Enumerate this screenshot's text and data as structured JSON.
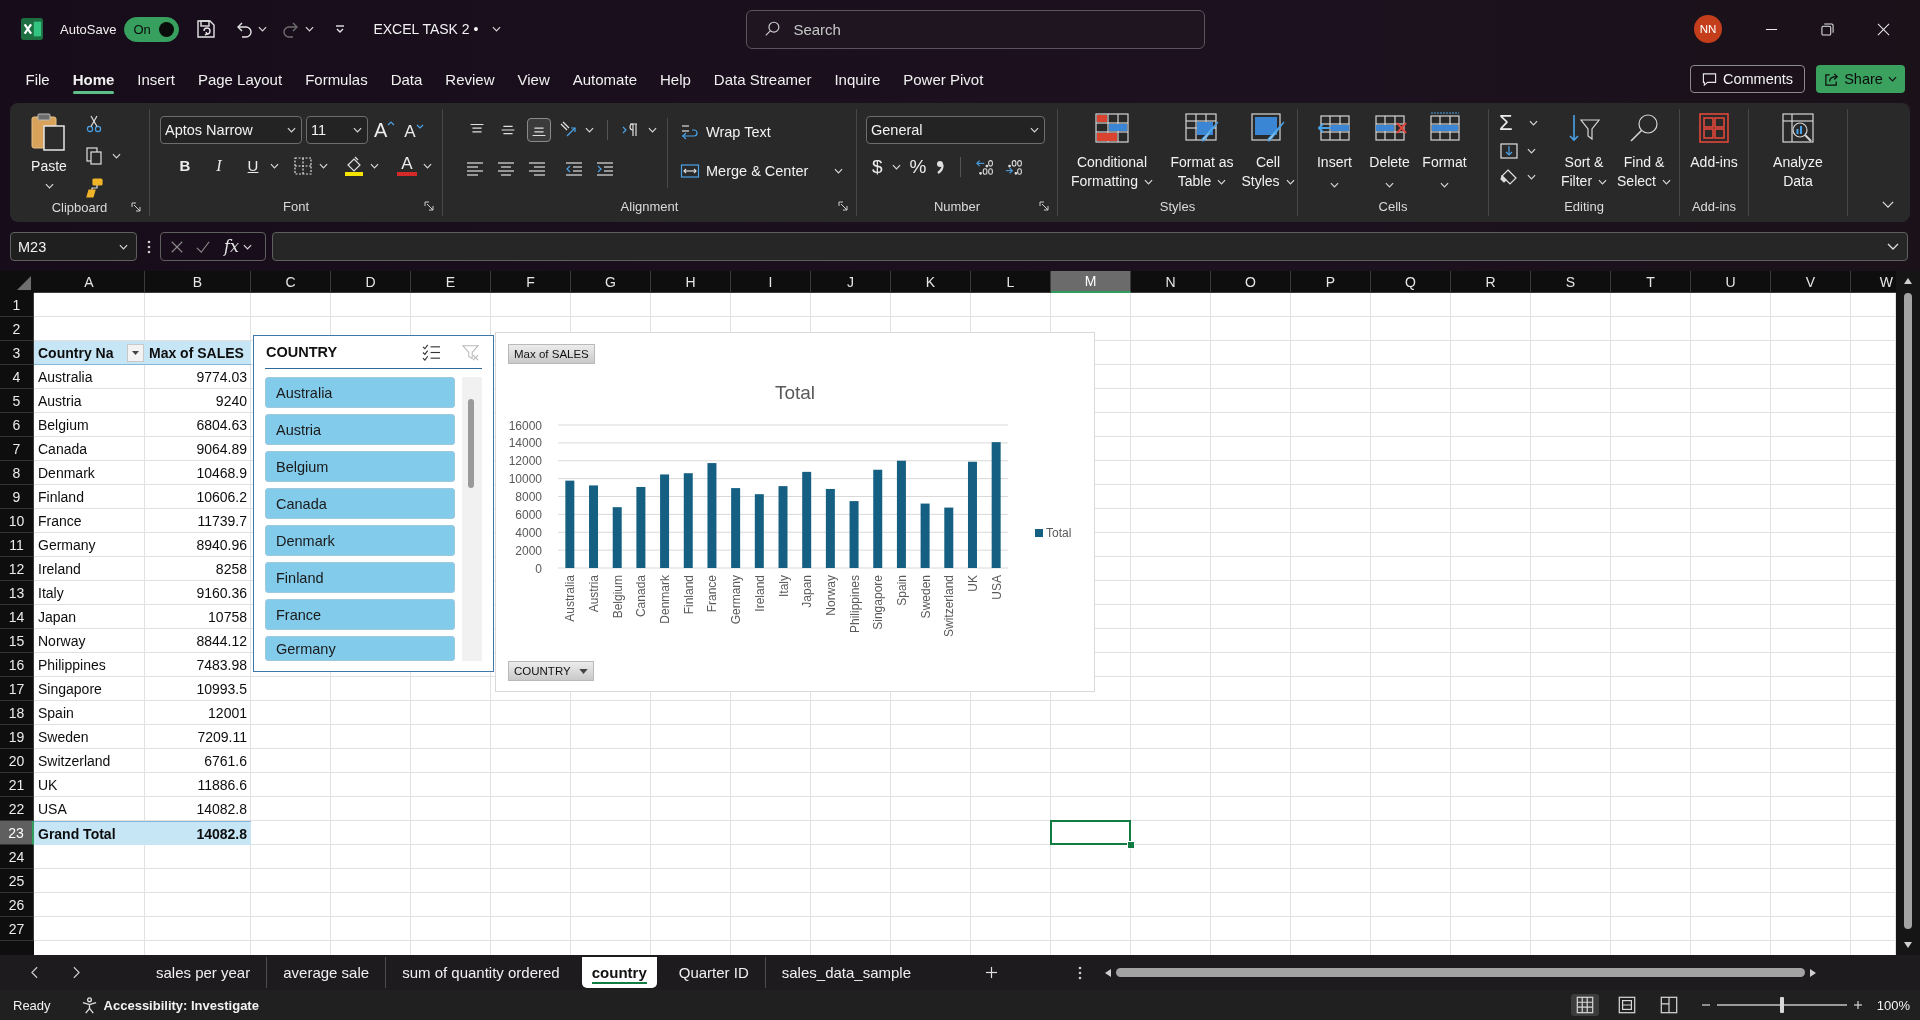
{
  "title_bar": {
    "autosave_label": "AutoSave",
    "autosave_toggle": {
      "label": "On",
      "on": true
    },
    "undo_enabled": true,
    "redo_enabled": false,
    "document_title": "EXCEL TASK 2 •",
    "search_placeholder": "Search",
    "account_initials": "NN"
  },
  "ribbon_tabs": [
    {
      "label": "File",
      "selected": false
    },
    {
      "label": "Home",
      "selected": true
    },
    {
      "label": "Insert",
      "selected": false
    },
    {
      "label": "Page Layout",
      "selected": false
    },
    {
      "label": "Formulas",
      "selected": false
    },
    {
      "label": "Data",
      "selected": false
    },
    {
      "label": "Review",
      "selected": false
    },
    {
      "label": "View",
      "selected": false
    },
    {
      "label": "Automate",
      "selected": false
    },
    {
      "label": "Help",
      "selected": false
    },
    {
      "label": "Data Streamer",
      "selected": false
    },
    {
      "label": "Inquire",
      "selected": false
    },
    {
      "label": "Power Pivot",
      "selected": false
    }
  ],
  "comments_button": "Comments",
  "share_button": "Share",
  "ribbon": {
    "clipboard": {
      "paste": "Paste",
      "group_label": "Clipboard"
    },
    "font": {
      "font_name": "Aptos Narrow",
      "font_size": "11",
      "grow_font": "A",
      "shrink_font": "A",
      "bold": "B",
      "italic": "I",
      "underline": "U",
      "font_color": "A",
      "group_label": "Font"
    },
    "alignment": {
      "vertical_buttons": [
        {
          "selected": false
        },
        {
          "selected": false
        },
        {
          "selected": true
        }
      ],
      "wrap_text": "Wrap Text",
      "merge_center": "Merge & Center",
      "group_label": "Alignment"
    },
    "number": {
      "format": "General",
      "currency": "$",
      "percent": "%",
      "group_label": "Number"
    },
    "styles": {
      "buttons": [
        {
          "lines": [
            "Conditional",
            "Formatting"
          ]
        },
        {
          "lines": [
            "Format as",
            "Table"
          ]
        },
        {
          "lines": [
            "Cell",
            "Styles"
          ]
        }
      ],
      "group_label": "Styles"
    },
    "cells": {
      "buttons": [
        "Insert",
        "Delete",
        "Format"
      ],
      "group_label": "Cells"
    },
    "editing": {
      "autosum": "Σ",
      "buttons": [
        {
          "lines": [
            "Sort &",
            "Filter"
          ]
        },
        {
          "lines": [
            "Find &",
            "Select"
          ]
        }
      ],
      "group_label": "Editing"
    },
    "add_ins": {
      "button": "Add-ins",
      "group_label": "Add-ins"
    },
    "analyze": {
      "lines": [
        "Analyze",
        "Data"
      ]
    }
  },
  "formula_bar": {
    "name_box": "M23",
    "function_label": "fx"
  },
  "sheet": {
    "columns": [
      {
        "label": "A",
        "selected": false
      },
      {
        "label": "B",
        "selected": false
      },
      {
        "label": "C",
        "selected": false
      },
      {
        "label": "D",
        "selected": false
      },
      {
        "label": "E",
        "selected": false
      },
      {
        "label": "F",
        "selected": false
      },
      {
        "label": "G",
        "selected": false
      },
      {
        "label": "H",
        "selected": false
      },
      {
        "label": "I",
        "selected": false
      },
      {
        "label": "J",
        "selected": false
      },
      {
        "label": "K",
        "selected": false
      },
      {
        "label": "L",
        "selected": false
      },
      {
        "label": "M",
        "selected": true
      },
      {
        "label": "N",
        "selected": false
      },
      {
        "label": "O",
        "selected": false
      },
      {
        "label": "P",
        "selected": false
      },
      {
        "label": "Q",
        "selected": false
      },
      {
        "label": "R",
        "selected": false
      },
      {
        "label": "S",
        "selected": false
      },
      {
        "label": "T",
        "selected": false
      },
      {
        "label": "U",
        "selected": false
      },
      {
        "label": "V",
        "selected": false
      },
      {
        "label": "W",
        "selected": false
      }
    ],
    "rows": [
      {
        "label": "1",
        "selected": false
      },
      {
        "label": "2",
        "selected": false
      },
      {
        "label": "3",
        "selected": false
      },
      {
        "label": "4",
        "selected": false
      },
      {
        "label": "5",
        "selected": false
      },
      {
        "label": "6",
        "selected": false
      },
      {
        "label": "7",
        "selected": false
      },
      {
        "label": "8",
        "selected": false
      },
      {
        "label": "9",
        "selected": false
      },
      {
        "label": "10",
        "selected": false
      },
      {
        "label": "11",
        "selected": false
      },
      {
        "label": "12",
        "selected": false
      },
      {
        "label": "13",
        "selected": false
      },
      {
        "label": "14",
        "selected": false
      },
      {
        "label": "15",
        "selected": false
      },
      {
        "label": "16",
        "selected": false
      },
      {
        "label": "17",
        "selected": false
      },
      {
        "label": "18",
        "selected": false
      },
      {
        "label": "19",
        "selected": false
      },
      {
        "label": "20",
        "selected": false
      },
      {
        "label": "21",
        "selected": false
      },
      {
        "label": "22",
        "selected": false
      },
      {
        "label": "23",
        "selected": true
      },
      {
        "label": "24",
        "selected": false
      },
      {
        "label": "25",
        "selected": false
      },
      {
        "label": "26",
        "selected": false
      },
      {
        "label": "27",
        "selected": false
      }
    ]
  },
  "pivot_table": {
    "headers": [
      "Country Na",
      "Max of SALES"
    ],
    "rows": [
      [
        "Australia",
        "9774.03"
      ],
      [
        "Austria",
        "9240"
      ],
      [
        "Belgium",
        "6804.63"
      ],
      [
        "Canada",
        "9064.89"
      ],
      [
        "Denmark",
        "10468.9"
      ],
      [
        "Finland",
        "10606.2"
      ],
      [
        "France",
        "11739.7"
      ],
      [
        "Germany",
        "8940.96"
      ],
      [
        "Ireland",
        "8258"
      ],
      [
        "Italy",
        "9160.36"
      ],
      [
        "Japan",
        "10758"
      ],
      [
        "Norway",
        "8844.12"
      ],
      [
        "Philippines",
        "7483.98"
      ],
      [
        "Singapore",
        "10993.5"
      ],
      [
        "Spain",
        "12001"
      ],
      [
        "Sweden",
        "7209.11"
      ],
      [
        "Switzerland",
        "6761.6"
      ],
      [
        "UK",
        "11886.6"
      ],
      [
        "USA",
        "14082.8"
      ]
    ],
    "grand_total": [
      "Grand Total",
      "14082.8"
    ]
  },
  "slicer": {
    "title": "COUNTRY",
    "clear_filter_enabled": false,
    "items": [
      {
        "label": "Australia",
        "selected": true
      },
      {
        "label": "Austria",
        "selected": true
      },
      {
        "label": "Belgium",
        "selected": true
      },
      {
        "label": "Canada",
        "selected": true
      },
      {
        "label": "Denmark",
        "selected": true
      },
      {
        "label": "Finland",
        "selected": true
      },
      {
        "label": "France",
        "selected": true
      },
      {
        "label": "Germany",
        "selected": true
      }
    ]
  },
  "chart": {
    "value_field_button": "Max of SALES",
    "axis_field_button": "COUNTRY",
    "chart_data": {
      "type": "bar",
      "title": "Total",
      "categories": [
        "Australia",
        "Austria",
        "Belgium",
        "Canada",
        "Denmark",
        "Finland",
        "France",
        "Germany",
        "Ireland",
        "Italy",
        "Japan",
        "Norway",
        "Philippines",
        "Singapore",
        "Spain",
        "Sweden",
        "Switzerland",
        "UK",
        "USA"
      ],
      "series": [
        {
          "name": "Total",
          "color": "#156082",
          "values": [
            9774.03,
            9240,
            6804.63,
            9064.89,
            10468.9,
            10606.2,
            11739.7,
            8940.96,
            8258,
            9160.36,
            10758,
            8844.12,
            7483.98,
            10993.5,
            12001,
            7209.11,
            6761.6,
            11886.6,
            14082.8
          ]
        }
      ],
      "yticks": [
        0,
        2000,
        4000,
        6000,
        8000,
        10000,
        12000,
        14000,
        16000
      ],
      "ylim": [
        0,
        16000
      ],
      "grid": true,
      "legend": "right"
    }
  },
  "sheet_tabs": [
    {
      "label": "sales per year",
      "selected": false
    },
    {
      "label": "average sale",
      "selected": false
    },
    {
      "label": "sum of quantity ordered",
      "selected": false
    },
    {
      "label": "country",
      "selected": true
    },
    {
      "label": "Quarter ID",
      "selected": false
    },
    {
      "label": "sales_data_sample",
      "selected": false
    }
  ],
  "status_bar": {
    "mode": "Ready",
    "accessibility": "Accessibility: Investigate",
    "view_buttons": [
      {
        "selected": true
      },
      {
        "selected": false
      },
      {
        "selected": false
      }
    ],
    "zoom": {
      "level": 0.5,
      "label": "100%"
    }
  }
}
